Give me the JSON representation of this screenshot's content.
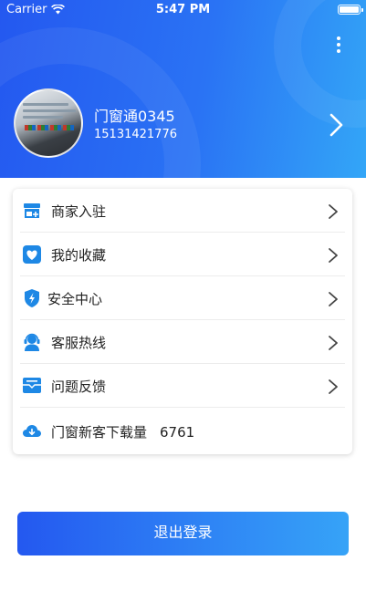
{
  "status_bar": {
    "carrier": "Carrier",
    "time": "5:47 PM"
  },
  "colors": {
    "accent_start": "#2458f0",
    "accent_end": "#36a3f7",
    "icon_blue": "#1e88e5"
  },
  "profile": {
    "name": "门窗通0345",
    "phone": "15131421776"
  },
  "menu": [
    {
      "label": "商家入驻",
      "icon": "store-add-icon"
    },
    {
      "label": "我的收藏",
      "icon": "heart-icon"
    },
    {
      "label": "安全中心",
      "icon": "shield-icon"
    },
    {
      "label": "客服热线",
      "icon": "headset-icon"
    },
    {
      "label": "问题反馈",
      "icon": "feedback-icon"
    },
    {
      "label": "门窗新客下载量",
      "count": "6761",
      "icon": "cloud-download-icon"
    }
  ],
  "logout_label": "退出登录"
}
